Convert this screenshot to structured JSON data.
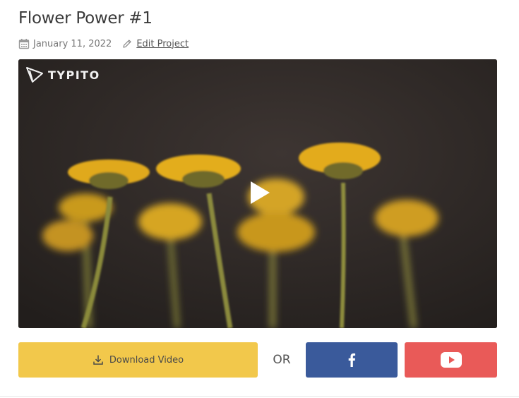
{
  "project": {
    "title": "Flower Power #1",
    "date": "January 11, 2022",
    "edit_label": "Edit Project"
  },
  "video": {
    "brand": "TYPITO",
    "brand_icon": "typito-logo-icon",
    "play_icon": "play-icon"
  },
  "actions": {
    "download_label": "Download Video",
    "or_label": "OR",
    "share_facebook_icon": "facebook-icon",
    "share_youtube_icon": "youtube-icon"
  },
  "colors": {
    "download": "#f2c84b",
    "facebook": "#3a5a9b",
    "youtube": "#e95a58"
  }
}
